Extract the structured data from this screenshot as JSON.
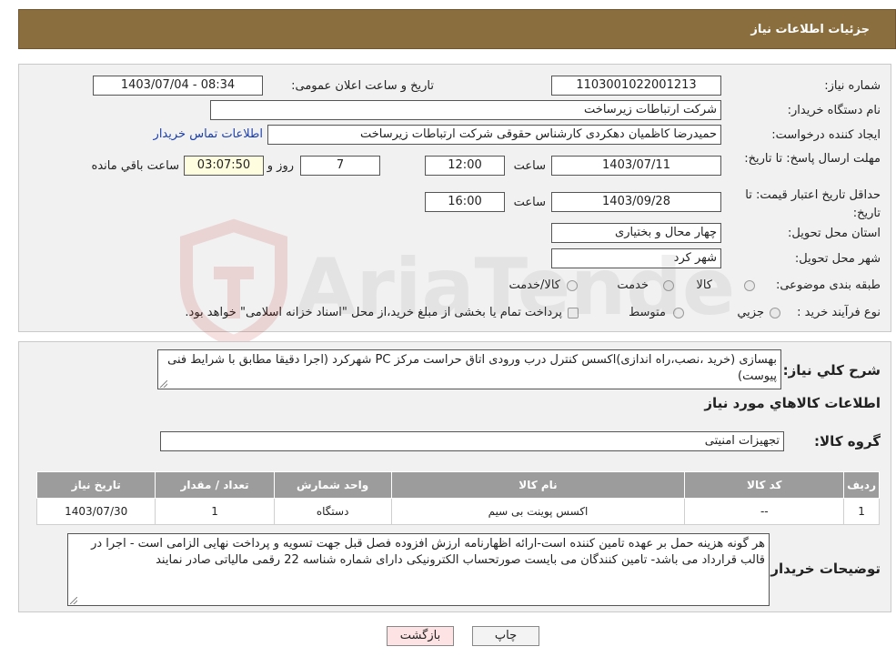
{
  "header": {
    "title": "جزئیات اطلاعات نیاز"
  },
  "form": {
    "need_number_label": "شماره نیاز:",
    "need_number": "1103001022001213",
    "announce_label": "تاریخ و ساعت اعلان عمومی:",
    "announce_value": "1403/07/04 - 08:34",
    "buyer_org_label": "نام دستگاه خریدار:",
    "buyer_org": "شرکت ارتباطات زیرساخت",
    "requester_label": "ایجاد کننده درخواست:",
    "requester": "حمیدرضا کاظمیان دهکردی کارشناس حقوقی شرکت ارتباطات زیرساخت",
    "buyer_contact_link": "اطلاعات تماس خریدار",
    "deadline_label": "مهلت ارسال پاسخ: تا تاریخ:",
    "deadline_date": "1403/07/11",
    "time_label": "ساعت",
    "deadline_time": "12:00",
    "days_value": "7",
    "days_label": "روز و",
    "remaining_time": "03:07:50",
    "remaining_label": "ساعت باقي مانده",
    "validity_label": "حداقل تاريخ اعتبار قيمت: تا تاريخ:",
    "validity_date": "1403/09/28",
    "validity_time": "16:00",
    "province_label": "استان محل تحویل:",
    "province": "چهار محال و بختیاری",
    "city_label": "شهر محل تحویل:",
    "city": "شهر کرد",
    "category_label": "طبقه بندی موضوعی:",
    "category_options": [
      "کالا",
      "خدمت",
      "کالا/خدمت"
    ],
    "process_label": "نوع فرآیند خرید :",
    "process_options": [
      "جزيي",
      "متوسط"
    ],
    "payment_note": "پرداخت تمام یا بخشی از مبلغ خرید،از محل \"اسناد خزانه اسلامی\" خواهد بود."
  },
  "description": {
    "label": "شرح کلي نياز:",
    "text": "بهسازی (خرید ،نصب،راه اندازی)اکسس کنترل درب ورودی اتاق حراست مرکز PC شهرکرد (اجرا  دقیقا مطابق با شرایط فنی پیوست)"
  },
  "goods": {
    "section_title": "اطلاعات کالاهاي مورد نياز",
    "group_label": "گروه کالا:",
    "group_value": "تجهیزات امنیتی",
    "columns": [
      "رديف",
      "کد کالا",
      "نام کالا",
      "واحد شمارش",
      "تعداد / مقدار",
      "تاريخ نياز"
    ],
    "rows": [
      [
        "1",
        "--",
        "اکسس پوینت بی سیم",
        "دستگاه",
        "1",
        "1403/07/30"
      ]
    ]
  },
  "buyer_notes": {
    "label": "توضیحات خریدار:",
    "text": "هر گونه هزینه حمل بر عهده تامین کننده است-ارائه اظهارنامه ارزش افزوده فصل قبل جهت تسویه و پرداخت نهایی الزامی است - اجرا در قالب قرارداد می باشد- تامین کنندگان می بایست صورتحساب الکترونیکی دارای شماره شناسه 22 رقمی مالیاتی  صادر نمایند"
  },
  "buttons": {
    "print": "چاپ",
    "back": "بازگشت"
  },
  "watermark": {
    "text": "AriaTender.neT"
  },
  "colors": {
    "header": "#8b6e3e",
    "table_header": "#9c9c9c",
    "link": "#1b3fae",
    "back_button": "#fde3e3"
  }
}
